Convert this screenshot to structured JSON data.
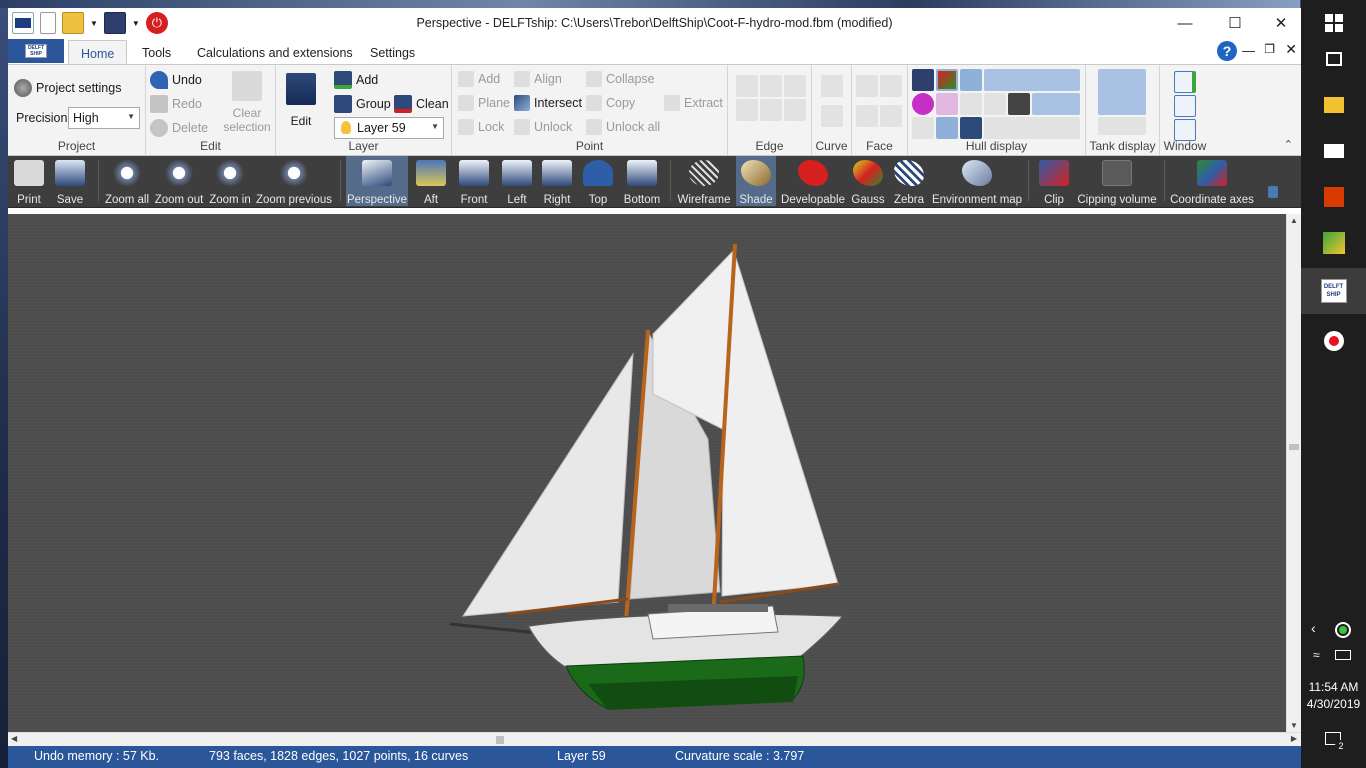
{
  "window": {
    "title": "Perspective - DELFTship: C:\\Users\\Trebor\\DelftShip\\Coot-F-hydro-mod.fbm (modified)",
    "app_logo_text": "DELFT SHIP"
  },
  "tabs": [
    "Home",
    "Tools",
    "Calculations and extensions",
    "Settings"
  ],
  "ribbon": {
    "project": {
      "label": "Project",
      "settings_label": "Project settings",
      "precision_label": "Precision",
      "precision_value": "High"
    },
    "edit": {
      "label": "Edit",
      "undo": "Undo",
      "redo": "Redo",
      "delete": "Delete",
      "clear_selection": "Clear selection"
    },
    "layer": {
      "label": "Layer",
      "edit": "Edit",
      "add": "Add",
      "group": "Group",
      "clean": "Clean",
      "active_layer": "Layer 59"
    },
    "point": {
      "label": "Point",
      "add": "Add",
      "align": "Align",
      "collapse": "Collapse",
      "plane": "Plane",
      "intersect": "Intersect",
      "copy": "Copy",
      "extract": "Extract",
      "lock": "Lock",
      "unlock": "Unlock",
      "unlock_all": "Unlock all"
    },
    "edge": {
      "label": "Edge"
    },
    "curve": {
      "label": "Curve"
    },
    "face": {
      "label": "Face"
    },
    "hull_display": {
      "label": "Hull display"
    },
    "tank_display": {
      "label": "Tank display"
    },
    "window_group": {
      "label": "Window"
    }
  },
  "toolbar": {
    "print": "Print",
    "save": "Save",
    "zoom_all": "Zoom all",
    "zoom_out": "Zoom out",
    "zoom_in": "Zoom in",
    "zoom_previous": "Zoom previous",
    "perspective": "Perspective",
    "aft": "Aft",
    "front": "Front",
    "left": "Left",
    "right": "Right",
    "top": "Top",
    "bottom": "Bottom",
    "wireframe": "Wireframe",
    "shade": "Shade",
    "developable": "Developable",
    "gauss": "Gauss",
    "zebra": "Zebra",
    "environment_map": "Environment map",
    "clip": "Clip",
    "clipping_volume": "Cipping volume",
    "coordinate_axes": "Coordinate axes"
  },
  "status": {
    "undo_memory": "Undo memory : 57 Kb.",
    "model_stats": "793 faces, 1828 edges, 1027 points, 16 curves",
    "layer": "Layer 59",
    "curvature": "Curvature scale : 3.797"
  },
  "taskbar": {
    "time": "11:54 AM",
    "date": "4/30/2019",
    "notifications": "2"
  },
  "colors": {
    "ribbon_bg": "#f3f3f3",
    "accent": "#2b579a",
    "viewport_bg": "#4d4d4d",
    "toolbar_bg": "#3e3e3e",
    "hull_green": "#1a6a1a"
  }
}
